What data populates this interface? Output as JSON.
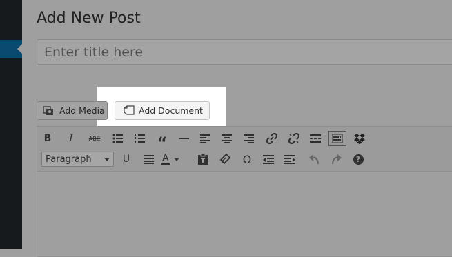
{
  "page": {
    "title": "Add New Post"
  },
  "title_field": {
    "placeholder": "Enter title here",
    "value": ""
  },
  "media_buttons": {
    "add_media": "Add Media",
    "add_document": "Add Document"
  },
  "toolbar": {
    "format_select": {
      "selected": "Paragraph"
    },
    "strikethrough_label": "ABC",
    "bold_label": "B",
    "italic_label": "I",
    "underline_label": "U",
    "text_color_label": "A",
    "special_char_label": "Ω",
    "help_label": "?"
  },
  "icons": [
    "bold-icon",
    "italic-icon",
    "strikethrough-icon",
    "bullet-list-icon",
    "numbered-list-icon",
    "blockquote-icon",
    "horizontal-rule-icon",
    "align-left-icon",
    "align-center-icon",
    "align-right-icon",
    "link-icon",
    "unlink-icon",
    "read-more-icon",
    "toolbar-toggle-icon",
    "dropbox-icon",
    "underline-icon",
    "justify-icon",
    "text-color-icon",
    "paste-as-text-icon",
    "clear-formatting-icon",
    "special-character-icon",
    "outdent-icon",
    "indent-icon",
    "undo-icon",
    "redo-icon",
    "help-icon"
  ],
  "colors": {
    "sidebar": "#171a1c",
    "sidebar_active": "#0a4a70",
    "overlay": "#9f9f9f",
    "highlight": "#ffffff"
  }
}
